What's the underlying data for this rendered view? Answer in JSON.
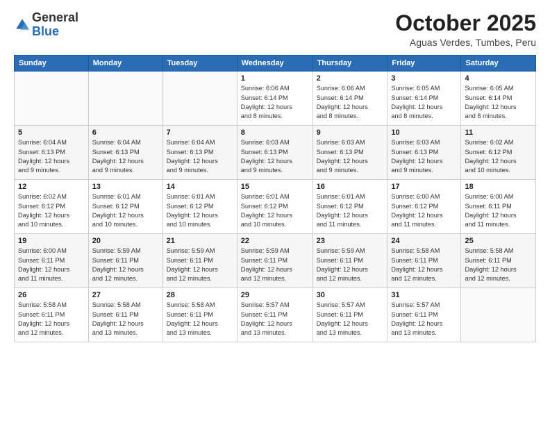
{
  "header": {
    "logo_general": "General",
    "logo_blue": "Blue",
    "month_title": "October 2025",
    "location": "Aguas Verdes, Tumbes, Peru"
  },
  "days_of_week": [
    "Sunday",
    "Monday",
    "Tuesday",
    "Wednesday",
    "Thursday",
    "Friday",
    "Saturday"
  ],
  "weeks": [
    [
      {
        "day": "",
        "info": ""
      },
      {
        "day": "",
        "info": ""
      },
      {
        "day": "",
        "info": ""
      },
      {
        "day": "1",
        "info": "Sunrise: 6:06 AM\nSunset: 6:14 PM\nDaylight: 12 hours\nand 8 minutes."
      },
      {
        "day": "2",
        "info": "Sunrise: 6:06 AM\nSunset: 6:14 PM\nDaylight: 12 hours\nand 8 minutes."
      },
      {
        "day": "3",
        "info": "Sunrise: 6:05 AM\nSunset: 6:14 PM\nDaylight: 12 hours\nand 8 minutes."
      },
      {
        "day": "4",
        "info": "Sunrise: 6:05 AM\nSunset: 6:14 PM\nDaylight: 12 hours\nand 8 minutes."
      }
    ],
    [
      {
        "day": "5",
        "info": "Sunrise: 6:04 AM\nSunset: 6:13 PM\nDaylight: 12 hours\nand 9 minutes."
      },
      {
        "day": "6",
        "info": "Sunrise: 6:04 AM\nSunset: 6:13 PM\nDaylight: 12 hours\nand 9 minutes."
      },
      {
        "day": "7",
        "info": "Sunrise: 6:04 AM\nSunset: 6:13 PM\nDaylight: 12 hours\nand 9 minutes."
      },
      {
        "day": "8",
        "info": "Sunrise: 6:03 AM\nSunset: 6:13 PM\nDaylight: 12 hours\nand 9 minutes."
      },
      {
        "day": "9",
        "info": "Sunrise: 6:03 AM\nSunset: 6:13 PM\nDaylight: 12 hours\nand 9 minutes."
      },
      {
        "day": "10",
        "info": "Sunrise: 6:03 AM\nSunset: 6:13 PM\nDaylight: 12 hours\nand 9 minutes."
      },
      {
        "day": "11",
        "info": "Sunrise: 6:02 AM\nSunset: 6:12 PM\nDaylight: 12 hours\nand 10 minutes."
      }
    ],
    [
      {
        "day": "12",
        "info": "Sunrise: 6:02 AM\nSunset: 6:12 PM\nDaylight: 12 hours\nand 10 minutes."
      },
      {
        "day": "13",
        "info": "Sunrise: 6:01 AM\nSunset: 6:12 PM\nDaylight: 12 hours\nand 10 minutes."
      },
      {
        "day": "14",
        "info": "Sunrise: 6:01 AM\nSunset: 6:12 PM\nDaylight: 12 hours\nand 10 minutes."
      },
      {
        "day": "15",
        "info": "Sunrise: 6:01 AM\nSunset: 6:12 PM\nDaylight: 12 hours\nand 10 minutes."
      },
      {
        "day": "16",
        "info": "Sunrise: 6:01 AM\nSunset: 6:12 PM\nDaylight: 12 hours\nand 11 minutes."
      },
      {
        "day": "17",
        "info": "Sunrise: 6:00 AM\nSunset: 6:12 PM\nDaylight: 12 hours\nand 11 minutes."
      },
      {
        "day": "18",
        "info": "Sunrise: 6:00 AM\nSunset: 6:11 PM\nDaylight: 12 hours\nand 11 minutes."
      }
    ],
    [
      {
        "day": "19",
        "info": "Sunrise: 6:00 AM\nSunset: 6:11 PM\nDaylight: 12 hours\nand 11 minutes."
      },
      {
        "day": "20",
        "info": "Sunrise: 5:59 AM\nSunset: 6:11 PM\nDaylight: 12 hours\nand 12 minutes."
      },
      {
        "day": "21",
        "info": "Sunrise: 5:59 AM\nSunset: 6:11 PM\nDaylight: 12 hours\nand 12 minutes."
      },
      {
        "day": "22",
        "info": "Sunrise: 5:59 AM\nSunset: 6:11 PM\nDaylight: 12 hours\nand 12 minutes."
      },
      {
        "day": "23",
        "info": "Sunrise: 5:59 AM\nSunset: 6:11 PM\nDaylight: 12 hours\nand 12 minutes."
      },
      {
        "day": "24",
        "info": "Sunrise: 5:58 AM\nSunset: 6:11 PM\nDaylight: 12 hours\nand 12 minutes."
      },
      {
        "day": "25",
        "info": "Sunrise: 5:58 AM\nSunset: 6:11 PM\nDaylight: 12 hours\nand 12 minutes."
      }
    ],
    [
      {
        "day": "26",
        "info": "Sunrise: 5:58 AM\nSunset: 6:11 PM\nDaylight: 12 hours\nand 12 minutes."
      },
      {
        "day": "27",
        "info": "Sunrise: 5:58 AM\nSunset: 6:11 PM\nDaylight: 12 hours\nand 13 minutes."
      },
      {
        "day": "28",
        "info": "Sunrise: 5:58 AM\nSunset: 6:11 PM\nDaylight: 12 hours\nand 13 minutes."
      },
      {
        "day": "29",
        "info": "Sunrise: 5:57 AM\nSunset: 6:11 PM\nDaylight: 12 hours\nand 13 minutes."
      },
      {
        "day": "30",
        "info": "Sunrise: 5:57 AM\nSunset: 6:11 PM\nDaylight: 12 hours\nand 13 minutes."
      },
      {
        "day": "31",
        "info": "Sunrise: 5:57 AM\nSunset: 6:11 PM\nDaylight: 12 hours\nand 13 minutes."
      },
      {
        "day": "",
        "info": ""
      }
    ]
  ]
}
